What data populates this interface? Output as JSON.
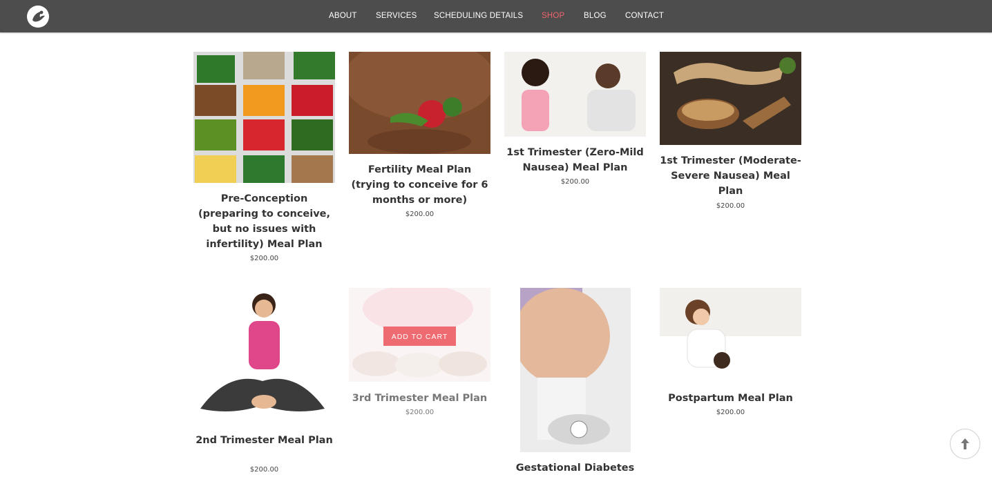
{
  "nav": {
    "items": [
      {
        "label": "ABOUT"
      },
      {
        "label": "SERVICES"
      },
      {
        "label": "SCHEDULING DETAILS"
      },
      {
        "label": "SHOP",
        "active": true
      },
      {
        "label": "BLOG"
      },
      {
        "label": "CONTACT"
      }
    ],
    "active_color": "#f0636a"
  },
  "products": [
    {
      "title": "Pre-Conception (preparing to conceive, but no issues with infertility) Meal Plan",
      "price": "$200.00",
      "image": "heart-bowls-vegetables"
    },
    {
      "title": "Fertility Meal Plan (trying to conceive for 6 months or more)",
      "price": "$200.00",
      "image": "hands-holding-vegetables"
    },
    {
      "title": "1st Trimester (Zero-Mild Nausea) Meal Plan",
      "price": "$200.00",
      "image": "couple-breakfast"
    },
    {
      "title": "1st Trimester (Moderate-Severe Nausea) Meal Plan",
      "price": "$200.00",
      "image": "ginger-root"
    },
    {
      "title": "2nd Trimester Meal Plan",
      "price": "$200.00",
      "image": "woman-sitting-yoga"
    },
    {
      "title": "3rd Trimester Meal Plan",
      "price": "$200.00",
      "image": "supplement-bowls",
      "button": "ADD TO CART"
    },
    {
      "title": "Gestational Diabetes",
      "price": "",
      "image": "pregnant-on-scale"
    },
    {
      "title": "Postpartum Meal Plan",
      "price": "$200.00",
      "image": "mother-nursing"
    }
  ],
  "scroll_top_icon": "arrow-up-icon"
}
